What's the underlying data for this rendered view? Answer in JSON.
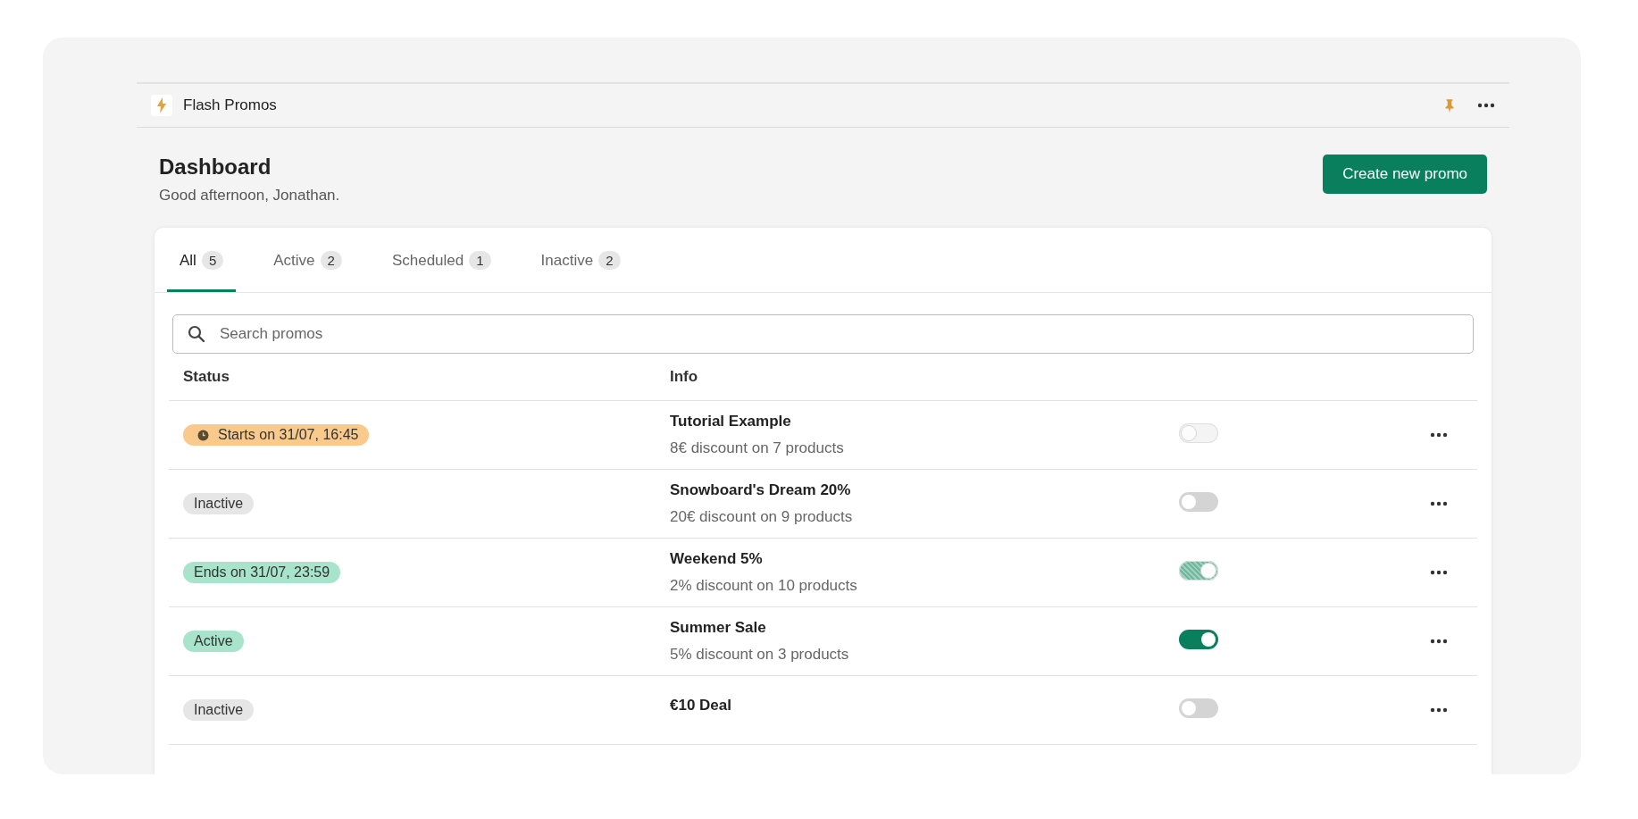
{
  "app": {
    "title": "Flash Promos"
  },
  "page": {
    "title": "Dashboard",
    "greeting": "Good afternoon, Jonathan.",
    "primary_button": "Create new promo"
  },
  "tabs": [
    {
      "label": "All",
      "count": "5",
      "selected": true
    },
    {
      "label": "Active",
      "count": "2",
      "selected": false
    },
    {
      "label": "Scheduled",
      "count": "1",
      "selected": false
    },
    {
      "label": "Inactive",
      "count": "2",
      "selected": false
    }
  ],
  "search": {
    "placeholder": "Search promos"
  },
  "table": {
    "columns": [
      "Status",
      "Info"
    ],
    "rows": [
      {
        "status": {
          "kind": "scheduled",
          "label": "Starts on 31/07, 16:45"
        },
        "name": "Tutorial Example",
        "detail": "8€ discount on 7 products",
        "toggle": {
          "on": false,
          "disabled": true
        }
      },
      {
        "status": {
          "kind": "inactive",
          "label": "Inactive"
        },
        "name": "Snowboard's Dream 20%",
        "detail": "20€ discount on 9 products",
        "toggle": {
          "on": false,
          "disabled": false
        }
      },
      {
        "status": {
          "kind": "ending",
          "label": "Ends on 31/07, 23:59"
        },
        "name": "Weekend 5%",
        "detail": "2% discount on 10 products",
        "toggle": {
          "on": true,
          "disabled": true
        }
      },
      {
        "status": {
          "kind": "active",
          "label": "Active"
        },
        "name": "Summer Sale",
        "detail": "5% discount on 3 products",
        "toggle": {
          "on": true,
          "disabled": false
        }
      },
      {
        "status": {
          "kind": "inactive",
          "label": "Inactive"
        },
        "name": "€10 Deal",
        "toggle": {
          "on": false,
          "disabled": false
        }
      }
    ]
  }
}
